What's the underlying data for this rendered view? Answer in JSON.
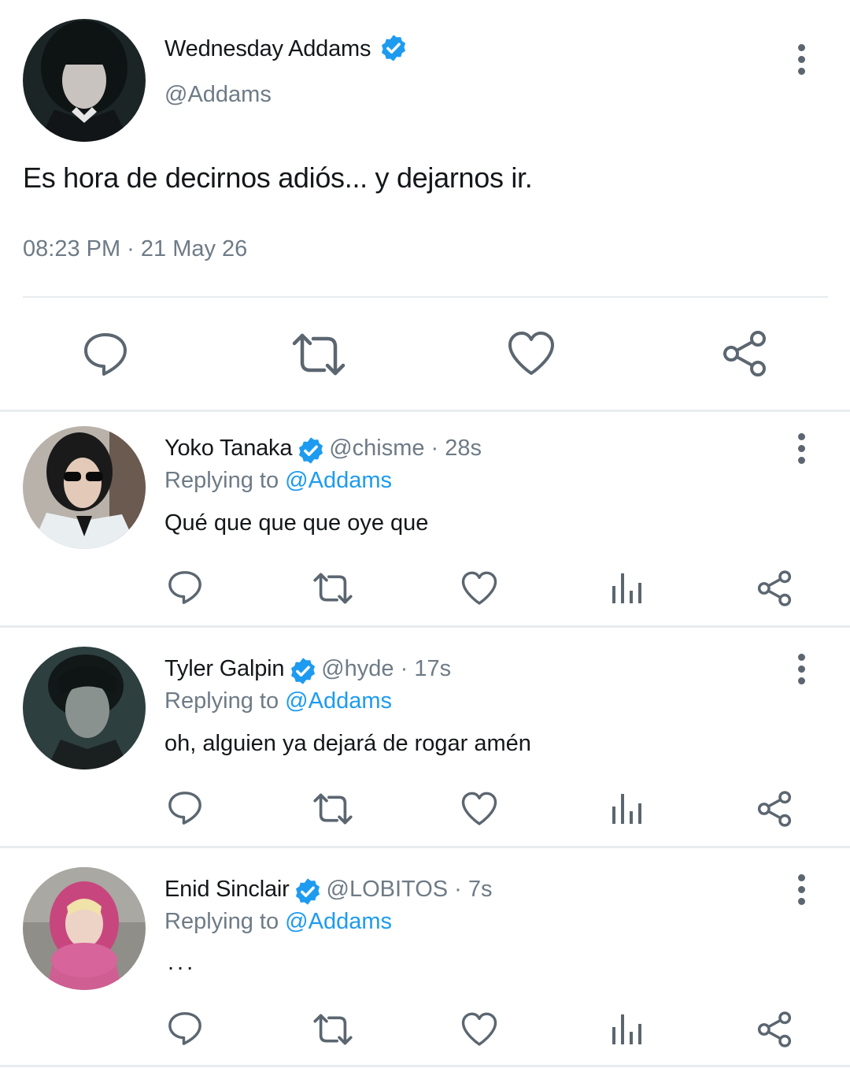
{
  "main_tweet": {
    "name": "Wednesday Addams",
    "handle": "@Addams",
    "text": "Es hora de decirnos adiós... y dejarnos ir.",
    "timestamp": "08:23 PM · 21 May 26",
    "actions": [
      "reply-icon",
      "retweet-icon",
      "like-icon",
      "share-icon"
    ]
  },
  "replies": [
    {
      "name": "Yoko Tanaka",
      "handle_time": "@chisme · 28s",
      "replying_label": "Replying to",
      "replying_handle": "@Addams",
      "text": "Qué que que que oye que"
    },
    {
      "name": "Tyler Galpin",
      "handle_time": "@hyde · 17s",
      "replying_label": "Replying to",
      "replying_handle": "@Addams",
      "text": "oh, alguien ya dejará de rogar amén"
    },
    {
      "name": "Enid Sinclair",
      "handle_time": "@LOBITOS · 7s",
      "replying_label": "Replying to",
      "replying_handle": "@Addams",
      "text": "..."
    }
  ],
  "colors": {
    "accent": "#1d9bf0",
    "icon": "#5b6670",
    "muted": "#6e7b86",
    "divider": "#e8ecef"
  }
}
